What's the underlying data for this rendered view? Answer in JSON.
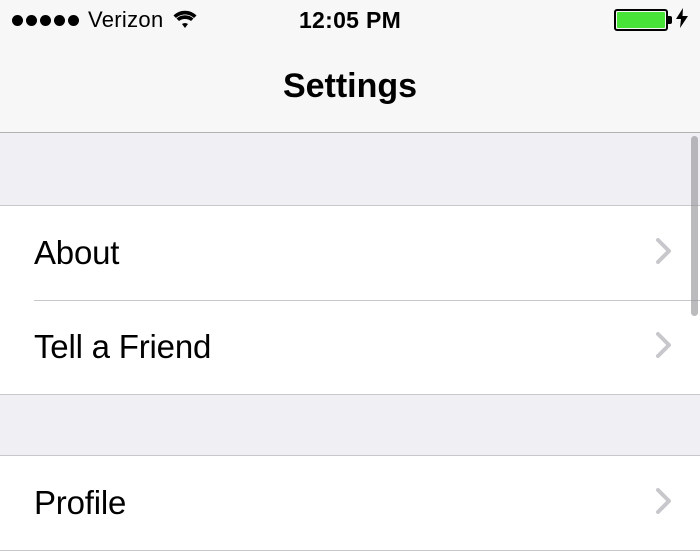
{
  "status": {
    "carrier": "Verizon",
    "time": "12:05 PM"
  },
  "nav": {
    "title": "Settings"
  },
  "sections": [
    {
      "items": [
        {
          "label": "About"
        },
        {
          "label": "Tell a Friend"
        }
      ]
    },
    {
      "items": [
        {
          "label": "Profile"
        }
      ]
    }
  ]
}
